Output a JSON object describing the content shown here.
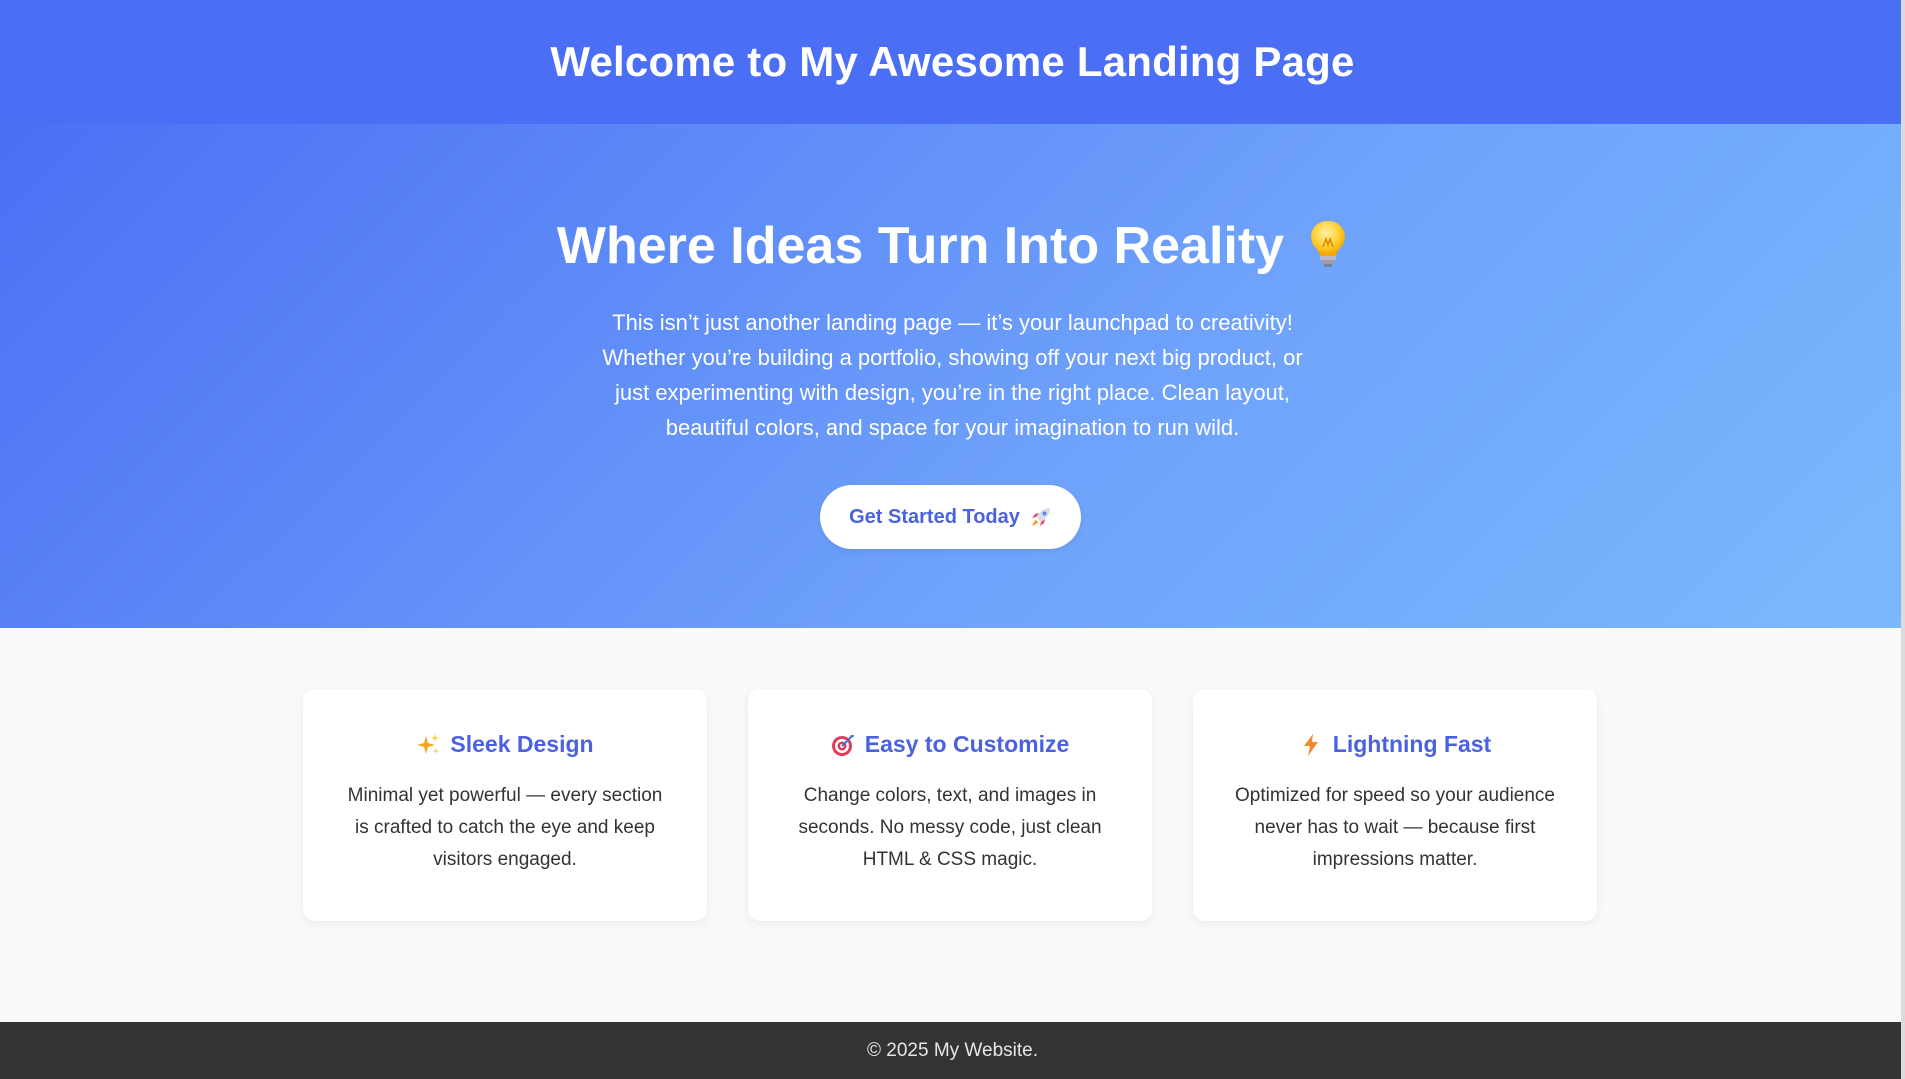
{
  "header": {
    "title": "Welcome to My Awesome Landing Page"
  },
  "hero": {
    "title": "Where Ideas Turn Into Reality",
    "title_icon": "lightbulb-icon",
    "text": "This isn’t just another landing page — it’s your launchpad to creativity! Whether you’re building a portfolio, showing off your next big product, or just experimenting with design, you’re in the right place. Clean layout, beautiful colors, and space for your imagination to run wild.",
    "cta_label": "Get Started Today",
    "cta_icon": "rocket-icon"
  },
  "features": [
    {
      "icon": "sparkles-icon",
      "title": "Sleek Design",
      "text": "Minimal yet powerful — every section is crafted to catch the eye and keep visitors engaged."
    },
    {
      "icon": "target-icon",
      "title": "Easy to Customize",
      "text": "Change colors, text, and images in seconds. No messy code, just clean HTML & CSS magic."
    },
    {
      "icon": "lightning-icon",
      "title": "Lightning Fast",
      "text": "Optimized for speed so your audience never has to wait — because first impressions matter."
    }
  ],
  "footer": {
    "text": "© 2025 My Website."
  },
  "colors": {
    "header_bg": "#4b6ff4",
    "hero_gradient_start": "#4b6ff4",
    "hero_gradient_end": "#7ab9fd",
    "accent": "#4b62e0",
    "features_bg": "#f9f9f9",
    "footer_bg": "#333333"
  }
}
